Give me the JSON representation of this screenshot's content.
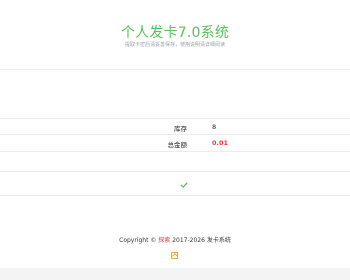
{
  "header": {
    "title": "个人发卡7.0系统",
    "subtitle": "提取卡密后请妥善保存，使用说明请详细阅读"
  },
  "stats": {
    "stock_label": "库存",
    "stock_value": "8",
    "total_label": "总金额",
    "total_value": "0.01"
  },
  "status": {
    "check_icon": "check-icon"
  },
  "footer": {
    "copyright_prefix": "Copyright ©",
    "link_text": "探索",
    "copyright_suffix": "2017-2026 发卡系统"
  },
  "colors": {
    "accent_green": "#58c15a",
    "money_red": "#e53935",
    "icon_orange": "#e6a43a"
  }
}
